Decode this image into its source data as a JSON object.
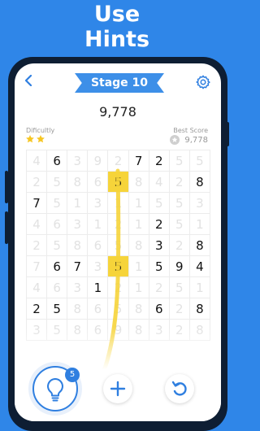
{
  "promo": {
    "line1": "Use",
    "line2": "Hints"
  },
  "header": {
    "back_icon": "chevron-left-icon",
    "stage": "Stage 10",
    "settings_icon": "gear-icon"
  },
  "score": "9,778",
  "difficulty": {
    "label": "Dificultly",
    "stars": 2
  },
  "best": {
    "label": "Best Score",
    "value": "9,778"
  },
  "grid": {
    "rows": [
      [
        "4",
        "6",
        "3",
        "9",
        "2",
        "7",
        "2",
        "5",
        "5"
      ],
      [
        "2",
        "5",
        "8",
        "6",
        "5",
        "8",
        "4",
        "2",
        "8"
      ],
      [
        "7",
        "5",
        "1",
        "3",
        "1",
        "1",
        "5",
        "5",
        "3"
      ],
      [
        "4",
        "6",
        "3",
        "1",
        "2",
        "1",
        "2",
        "5",
        "1"
      ],
      [
        "2",
        "5",
        "8",
        "6",
        "5",
        "8",
        "3",
        "2",
        "8"
      ],
      [
        "7",
        "6",
        "7",
        "3",
        "5",
        "1",
        "5",
        "9",
        "4"
      ],
      [
        "4",
        "6",
        "3",
        "1",
        "2",
        "1",
        "2",
        "5",
        "1"
      ],
      [
        "2",
        "5",
        "8",
        "6",
        "5",
        "8",
        "6",
        "2",
        "8"
      ],
      [
        "3",
        "5",
        "8",
        "6",
        "9",
        "8",
        "3",
        "2",
        "8"
      ]
    ],
    "active": [
      [
        0,
        1,
        0,
        0,
        0,
        1,
        1,
        0,
        0
      ],
      [
        0,
        0,
        0,
        0,
        1,
        0,
        0,
        0,
        1
      ],
      [
        1,
        0,
        0,
        0,
        0,
        0,
        0,
        0,
        0
      ],
      [
        0,
        0,
        0,
        0,
        0,
        0,
        1,
        0,
        0
      ],
      [
        0,
        0,
        0,
        0,
        0,
        0,
        1,
        0,
        1
      ],
      [
        0,
        1,
        1,
        0,
        1,
        0,
        1,
        1,
        1
      ],
      [
        0,
        0,
        0,
        1,
        0,
        0,
        0,
        0,
        0
      ],
      [
        1,
        1,
        0,
        0,
        0,
        0,
        1,
        0,
        1
      ],
      [
        0,
        0,
        0,
        0,
        0,
        0,
        0,
        0,
        0
      ]
    ],
    "highlighted": [
      [
        1,
        4
      ],
      [
        5,
        4
      ]
    ],
    "highlight_color": "#f6d43a"
  },
  "bottom": {
    "hint_icon": "lightbulb-icon",
    "hint_count": "5",
    "add_icon": "plus-icon",
    "undo_icon": "undo-icon"
  },
  "colors": {
    "background": "#2f86e8",
    "accent": "#2f7fe0",
    "trail": "#f6d43a"
  }
}
